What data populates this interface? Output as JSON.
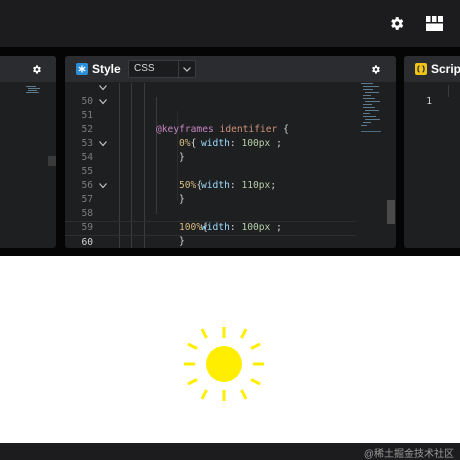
{
  "topbar": {
    "settings_icon": "gear-icon",
    "layout_icon": "layout-grid-icon"
  },
  "panels": {
    "left": {
      "settings_icon": "gear-icon"
    },
    "style": {
      "title": "Style",
      "icon": "css-logo-icon",
      "icon_color": "#2a8fd8",
      "language": "CSS",
      "settings_icon": "gear-icon",
      "lines": [
        {
          "num": "50",
          "fold": true
        },
        {
          "num": "51",
          "fold": true
        },
        {
          "num": "52",
          "fold": false
        },
        {
          "num": "53",
          "fold": false
        },
        {
          "num": "54",
          "fold": true
        },
        {
          "num": "55",
          "fold": false
        },
        {
          "num": "56",
          "fold": false
        },
        {
          "num": "57",
          "fold": true
        },
        {
          "num": "58",
          "fold": false
        },
        {
          "num": "59",
          "fold": false
        },
        {
          "num": "60",
          "fold": false
        }
      ],
      "code": {
        "l50_kw": "@keyframes",
        "l50_id": "identifier",
        "l50_brace": " {",
        "l51_sel": "0%",
        "l51_brace": "{",
        "l52_prop": "width",
        "l52_colon": ": ",
        "l52_val": "100px",
        "l52_end": " ;",
        "l53": "}",
        "l54_sel": "50%",
        "l54_brace": "{",
        "l55_prop": "width",
        "l55_colon": ": ",
        "l55_val": "110px",
        "l55_end": ";",
        "l56": "}",
        "l57_sel": "100%",
        "l57_brace": "{",
        "l58_prop": "width",
        "l58_colon": ": ",
        "l58_val": "100px",
        "l58_end": " ;",
        "l59": "}",
        "l60": "}"
      }
    },
    "script": {
      "title": "Script",
      "icon": "js-logo-icon",
      "icon_color": "#f0c419",
      "line_number": "1"
    }
  },
  "preview": {
    "sun_icon": "sun-icon",
    "sun_color": "#ffee00"
  },
  "footer": {
    "watermark": "@稀土掘金技术社区"
  }
}
